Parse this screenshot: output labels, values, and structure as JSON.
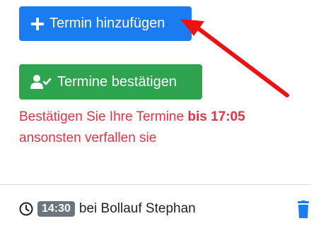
{
  "buttons": {
    "add_label": "Termin hinzufügen",
    "confirm_label": "Termine bestätigen"
  },
  "notice": {
    "line1_prefix": "Bestätigen Sie Ihre Termine ",
    "line1_deadline": "bis 17:05",
    "line2": "ansonsten verfallen sie"
  },
  "appointment": {
    "time": "14:30",
    "text": "bei Bollauf Stephan"
  },
  "icons": {
    "add": "plus-icon",
    "confirm": "user-check-icon",
    "time": "clock-icon",
    "delete": "trash-icon",
    "annotation": "red-arrow-icon"
  },
  "colors": {
    "primary": "#1a7cf0",
    "success": "#2ea44f",
    "danger": "#dc3545",
    "badge": "#6c757d",
    "arrow": "#ee1111"
  }
}
